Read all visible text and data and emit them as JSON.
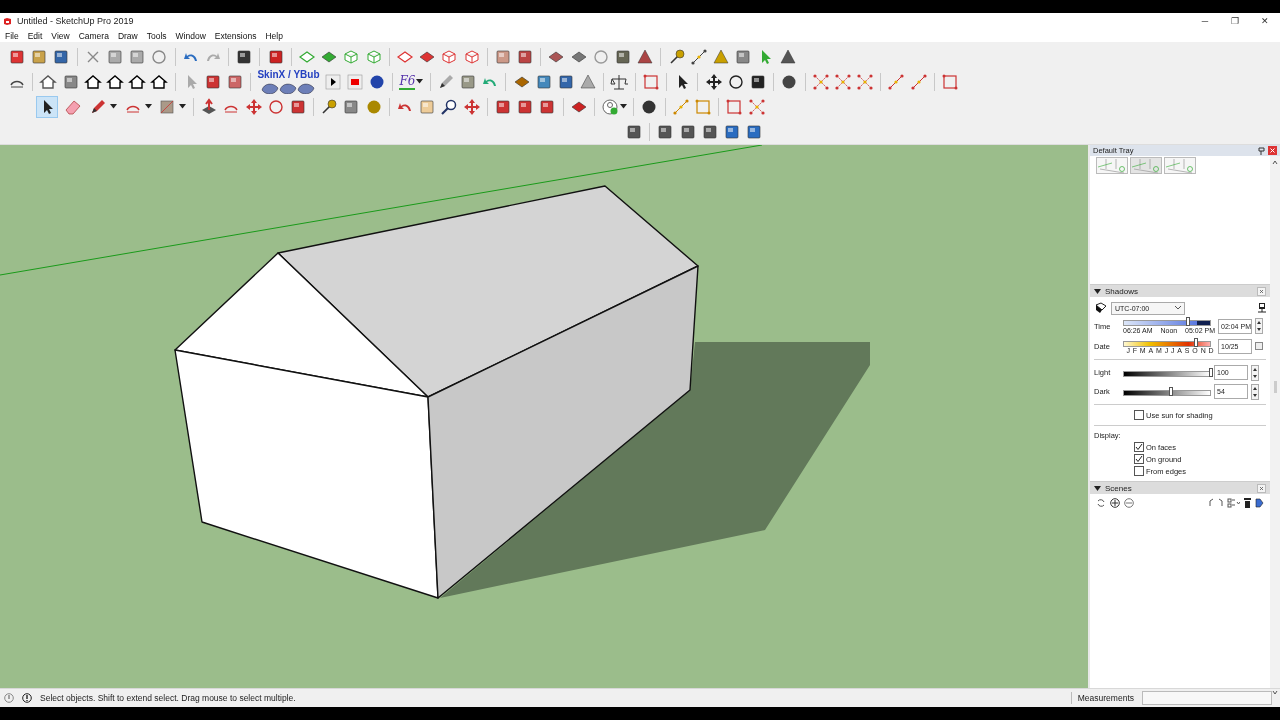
{
  "window": {
    "title": "Untitled - SketchUp Pro 2019",
    "controls": [
      "─",
      "❐",
      "✕"
    ]
  },
  "menu": [
    "File",
    "Edit",
    "View",
    "Camera",
    "Draw",
    "Tools",
    "Window",
    "Extensions",
    "Help"
  ],
  "toolbar": {
    "plugin_label": "SkinX / YBub",
    "f6_label": "F6",
    "drawing_tools": [
      {
        "selected": true,
        "dropdown": false
      },
      {
        "selected": false,
        "dropdown": false
      },
      {
        "selected": false,
        "dropdown": true
      },
      {
        "selected": false,
        "dropdown": true
      },
      {
        "selected": false,
        "dropdown": true
      }
    ]
  },
  "tray": {
    "title": "Default Tray",
    "shadows": {
      "title": "Shadows",
      "expanded": true,
      "timezone": "UTC-07:00",
      "time": {
        "label": "Time",
        "level": 0.74,
        "ticks": [
          "06:26 AM",
          "Noon",
          "05:02 PM"
        ],
        "value": "02:04 PM"
      },
      "date": {
        "label": "Date",
        "level": 0.83,
        "months": [
          "J",
          "F",
          "M",
          "A",
          "M",
          "J",
          "J",
          "A",
          "S",
          "O",
          "N",
          "D"
        ],
        "value": "10/25"
      },
      "light": {
        "label": "Light",
        "level": 1,
        "value": "100"
      },
      "dark": {
        "label": "Dark",
        "level": 0.54,
        "value": "54"
      },
      "use_sun": {
        "label": "Use sun for shading",
        "checked": false
      },
      "display_label": "Display:",
      "display": [
        {
          "label": "On faces",
          "checked": true
        },
        {
          "label": "On ground",
          "checked": true
        },
        {
          "label": "From edges",
          "checked": false
        }
      ]
    },
    "scenes": {
      "title": "Scenes",
      "expanded": true
    }
  },
  "status_bar": {
    "hint": "Select objects. Shift to extend select. Drag mouse to select multiple.",
    "measurements_label": "Measurements"
  }
}
